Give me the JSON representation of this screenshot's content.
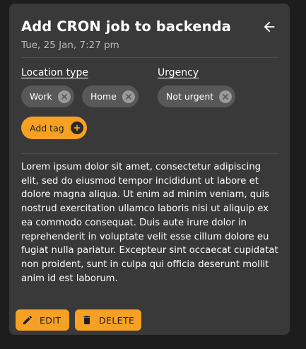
{
  "card": {
    "title": "Add CRON job to backenda",
    "subtitle": "Tue, 25 Jan, 7:27 pm"
  },
  "location": {
    "label": "Location type",
    "tags": [
      "Work",
      "Home"
    ]
  },
  "urgency": {
    "label": "Urgency",
    "tags": [
      "Not urgent"
    ]
  },
  "add_tag_label": "Add tag",
  "body": "Lorem ipsum dolor sit amet, consectetur adipiscing elit, sed do eiusmod tempor incididunt ut labore et dolore magna aliqua. Ut enim ad minim veniam, quis nostrud exercitation ullamco laboris nisi ut aliquip ex ea commodo consequat. Duis aute irure dolor in reprehenderit in voluptate velit esse cillum dolore eu fugiat nulla pariatur. Excepteur sint occaecat cupidatat non proident, sunt in culpa qui officia deserunt mollit anim id est laborum.",
  "actions": {
    "edit_label": "EDIT",
    "delete_label": "DELETE"
  },
  "icons": {
    "back": "arrow-left-icon",
    "remove": "close-circle-icon",
    "add": "plus-circle-icon",
    "edit": "pencil-icon",
    "delete": "trash-icon"
  },
  "colors": {
    "accent": "#f6a123",
    "card_bg": "#393939",
    "page_bg": "#1d1d1d",
    "chip_bg": "#585858"
  }
}
